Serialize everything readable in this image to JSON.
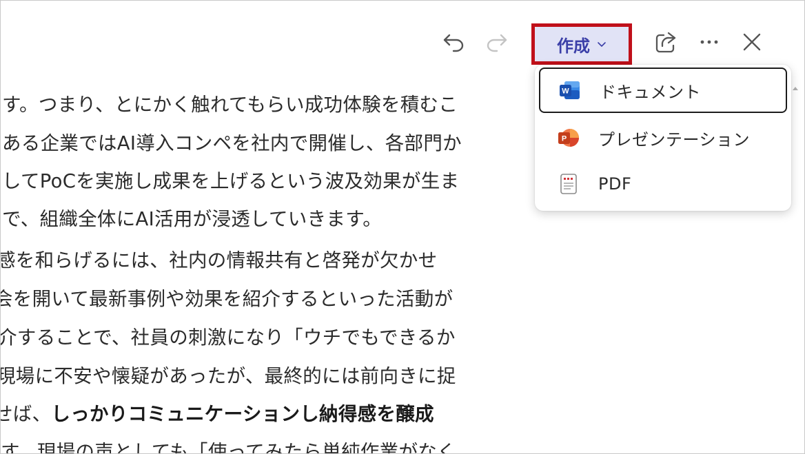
{
  "toolbar": {
    "undo_icon": "undo-icon",
    "redo_icon": "redo-icon",
    "create_label": "作成",
    "share_icon": "share-icon",
    "more_icon": "more-icon",
    "close_icon": "close-icon"
  },
  "document": {
    "lines": [
      "す。つまり、とにかく触れてもらい成功体験を積むこ",
      "ある企業ではAI導入コンペを社内で開催し、各部門か",
      "してPoCを実施し成果を上げるという波及効果が生ま",
      "で、組織全体にAI活用が浸透していきます。",
      "感を和らげるには、社内の情報共有と啓発が欠かせ",
      "会を開いて最新事例や効果を紹介するといった活動が",
      "介することで、社員の刺激になり「ウチでもできるか",
      "現場に不安や懐疑があったが、最終的には前向きに捉",
      "せば、",
      "しっかりコミュニケーションし納得感を醸成",
      "す。現場の声としても「使ってみたら単純作業がなく"
    ]
  },
  "create_menu": {
    "items": [
      {
        "label": "ドキュメント",
        "icon": "word-icon",
        "color": "#1e5fc8"
      },
      {
        "label": "プレゼンテーション",
        "icon": "powerpoint-icon",
        "color": "#d04a2a"
      },
      {
        "label": "PDF",
        "icon": "pdf-icon",
        "color": "#c4262e"
      }
    ]
  },
  "colors": {
    "highlight_border": "#c0101a",
    "create_button_bg": "#e1e3f6",
    "create_button_text": "#3b3fa8"
  }
}
